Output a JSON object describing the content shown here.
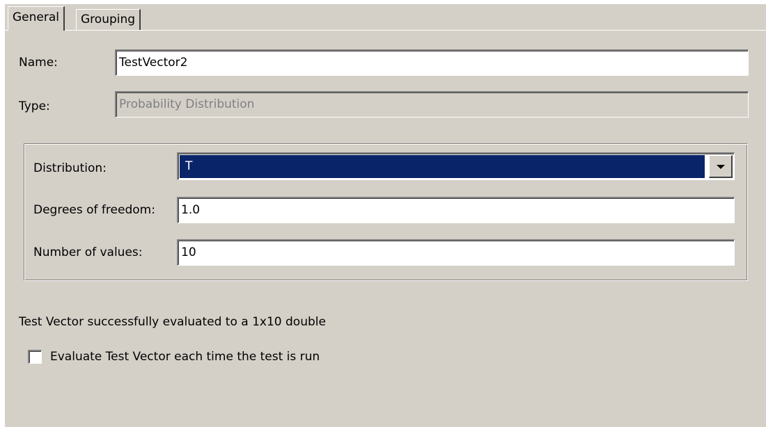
{
  "tabs": [
    {
      "label": "General",
      "selected": true
    },
    {
      "label": "Grouping",
      "selected": false
    }
  ],
  "name": {
    "label": "Name:",
    "value": "TestVector2"
  },
  "type": {
    "label": "Type:",
    "value": "Probability Distribution",
    "disabled": true
  },
  "distribution": {
    "label": "Distribution:",
    "selected": "T",
    "highlight_color": "#0a246a"
  },
  "degrees_of_freedom": {
    "label": "Degrees of freedom:",
    "value": "1.0"
  },
  "number_of_values": {
    "label": "Number of values:",
    "value": "10"
  },
  "status_message": "Test Vector successfully evaluated to a 1x10 double",
  "evaluate_checkbox": {
    "label": "Evaluate Test Vector each time the test is run",
    "checked": false
  },
  "colors": {
    "dialog_background": "#d4d0c8",
    "field_background": "#ffffff",
    "disabled_text": "#808080",
    "selection_text": "#ffffff"
  },
  "icons": {
    "dropdown": "chevron-down-icon"
  }
}
